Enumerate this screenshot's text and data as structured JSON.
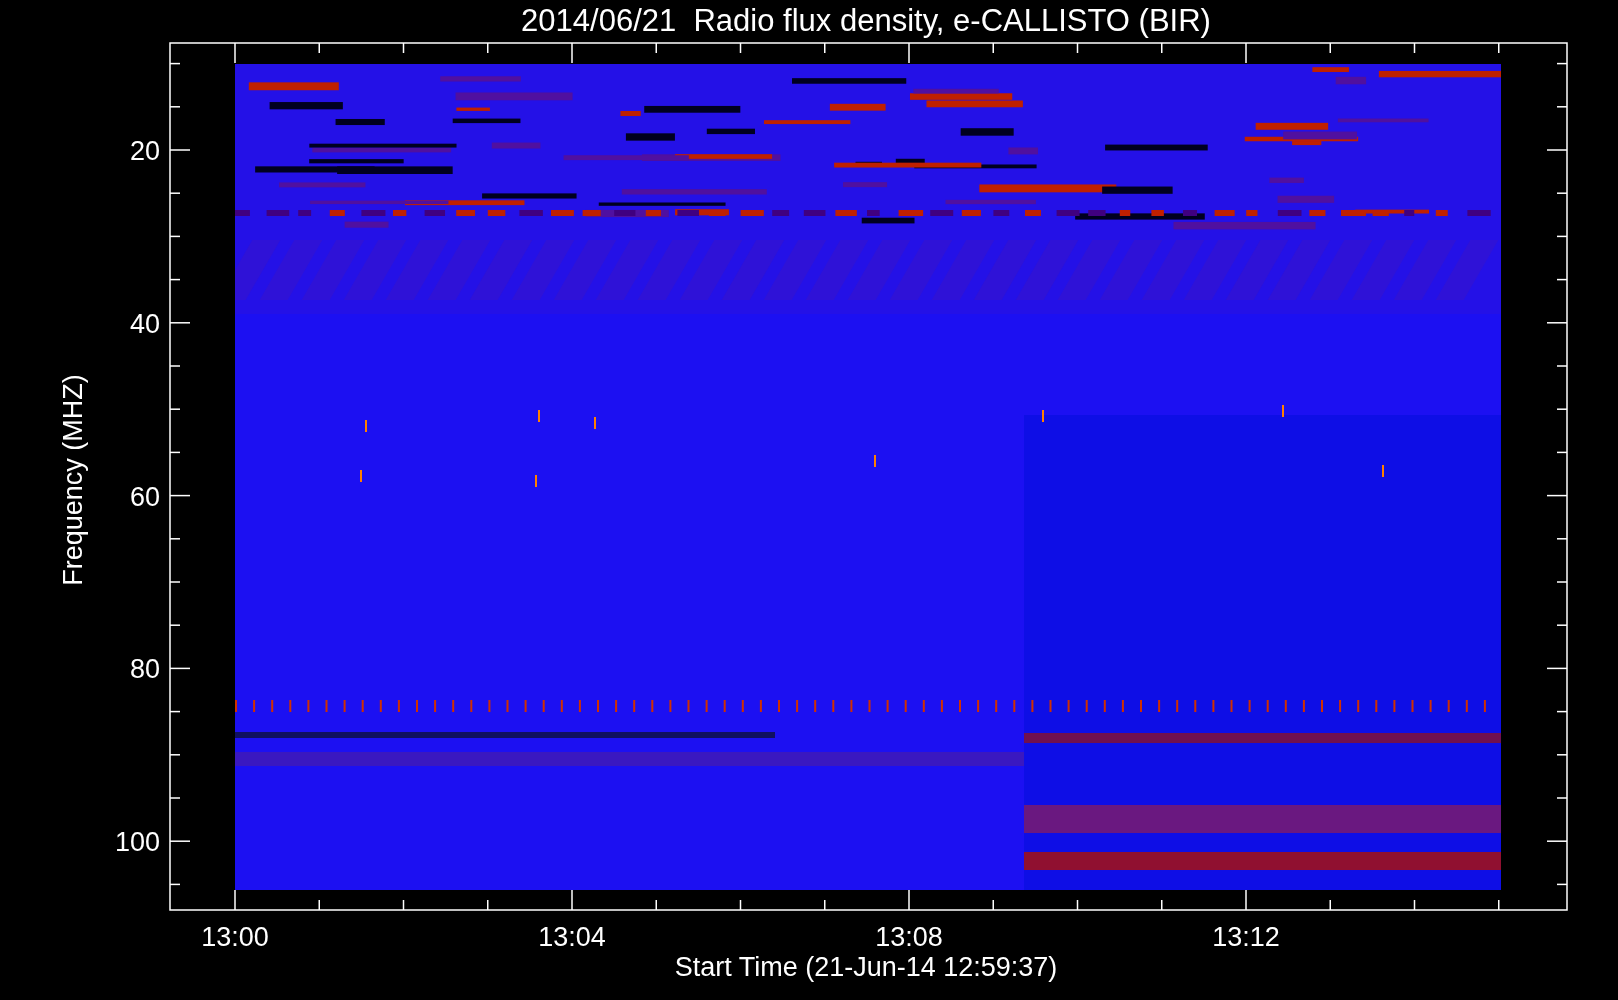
{
  "title": "2014/06/21  Radio flux density, e-CALLISTO (BIR)",
  "y_axis": {
    "label": "Frequency (MHZ)",
    "ticks": [
      "20",
      "40",
      "60",
      "80",
      "100"
    ]
  },
  "x_axis": {
    "label": "Start Time (21-Jun-14 12:59:37)",
    "ticks": [
      "13:00",
      "13:04",
      "13:08",
      "13:12"
    ]
  }
}
